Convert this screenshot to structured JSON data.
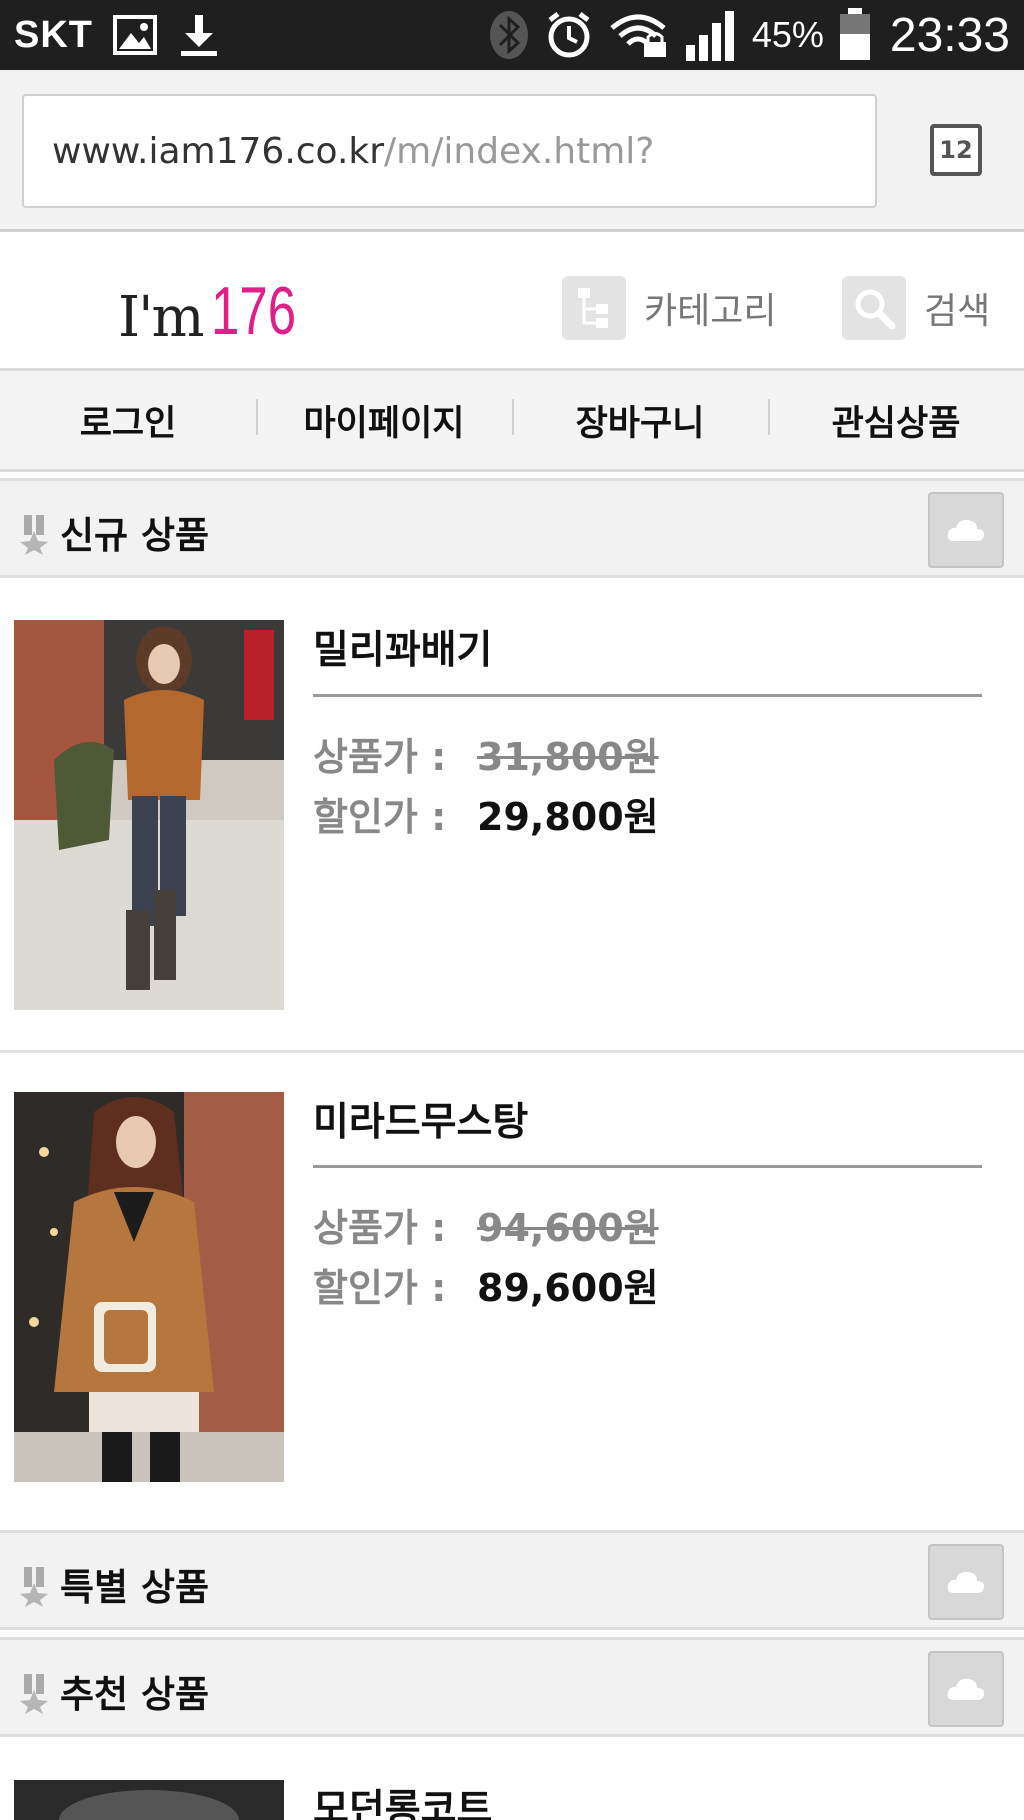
{
  "status_bar": {
    "carrier": "SKT",
    "battery_percent": "45%",
    "time": "23:33",
    "icons": [
      "image-icon",
      "download-icon",
      "bluetooth-icon",
      "alarm-icon",
      "wifi-lock-icon",
      "signal-icon",
      "battery-icon"
    ]
  },
  "browser": {
    "url_domain": "www.iam176.co.kr",
    "url_path": "/m/index.html?",
    "tab_count": "12"
  },
  "header": {
    "logo_text": "I'm",
    "logo_number": "176",
    "logo_accent_color": "#e0208a",
    "category_label": "카테고리",
    "search_label": "검색"
  },
  "nav": {
    "items": [
      {
        "label": "로그인"
      },
      {
        "label": "마이페이지"
      },
      {
        "label": "장바구니"
      },
      {
        "label": "관심상품"
      }
    ]
  },
  "sections": [
    {
      "title": "신규 상품"
    },
    {
      "title": "특별 상품"
    },
    {
      "title": "추천 상품"
    }
  ],
  "products": [
    {
      "name": "밀리꽈배기",
      "price_label": "상품가 :",
      "price": "31,800원",
      "sale_label": "할인가 :",
      "sale_price": "29,800원"
    },
    {
      "name": "미라드무스탕",
      "price_label": "상품가 :",
      "price": "94,600원",
      "sale_label": "할인가 :",
      "sale_price": "89,600원"
    },
    {
      "name": "모던롱코트"
    }
  ]
}
